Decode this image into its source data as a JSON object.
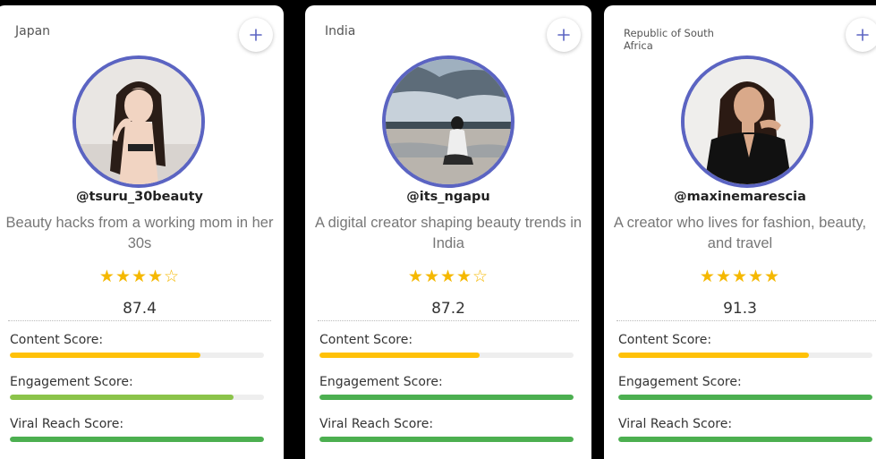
{
  "score_labels": {
    "content": "Content Score:",
    "engagement": "Engagement Score:",
    "viral": "Viral Reach Score:"
  },
  "colors": {
    "avatar_ring": "#5B64C2",
    "star": "#F5B800",
    "content_bar": "#FFC107",
    "engagement_bar_light": "#8BC34A",
    "engagement_bar": "#4CAF50",
    "viral_bar": "#4CAF50"
  },
  "cards": [
    {
      "country": "Japan",
      "handle": "@tsuru_30beauty",
      "bio": "Beauty hacks from a working mom in her 30s",
      "stars": "★★★★☆",
      "rating": "4 of 5",
      "score": "87.4",
      "content_score_pct": 75,
      "engagement_score_pct": 88,
      "viral_score_pct": 100,
      "add_icon": "plus-icon"
    },
    {
      "country": "India",
      "handle": "@its_ngapu",
      "bio": "A digital creator shaping beauty trends in India",
      "stars": "★★★★☆",
      "rating": "4 of 5",
      "score": "87.2",
      "content_score_pct": 63,
      "engagement_score_pct": 100,
      "viral_score_pct": 100,
      "add_icon": "plus-icon"
    },
    {
      "country": "Republic of South Africa",
      "handle": "@maxinemarescia",
      "bio": "A creator who lives for fashion, beauty, and travel",
      "stars": "★★★★★",
      "rating": "5 of 5",
      "score": "91.3",
      "content_score_pct": 75,
      "engagement_score_pct": 100,
      "viral_score_pct": 100,
      "add_icon": "plus-icon"
    }
  ]
}
